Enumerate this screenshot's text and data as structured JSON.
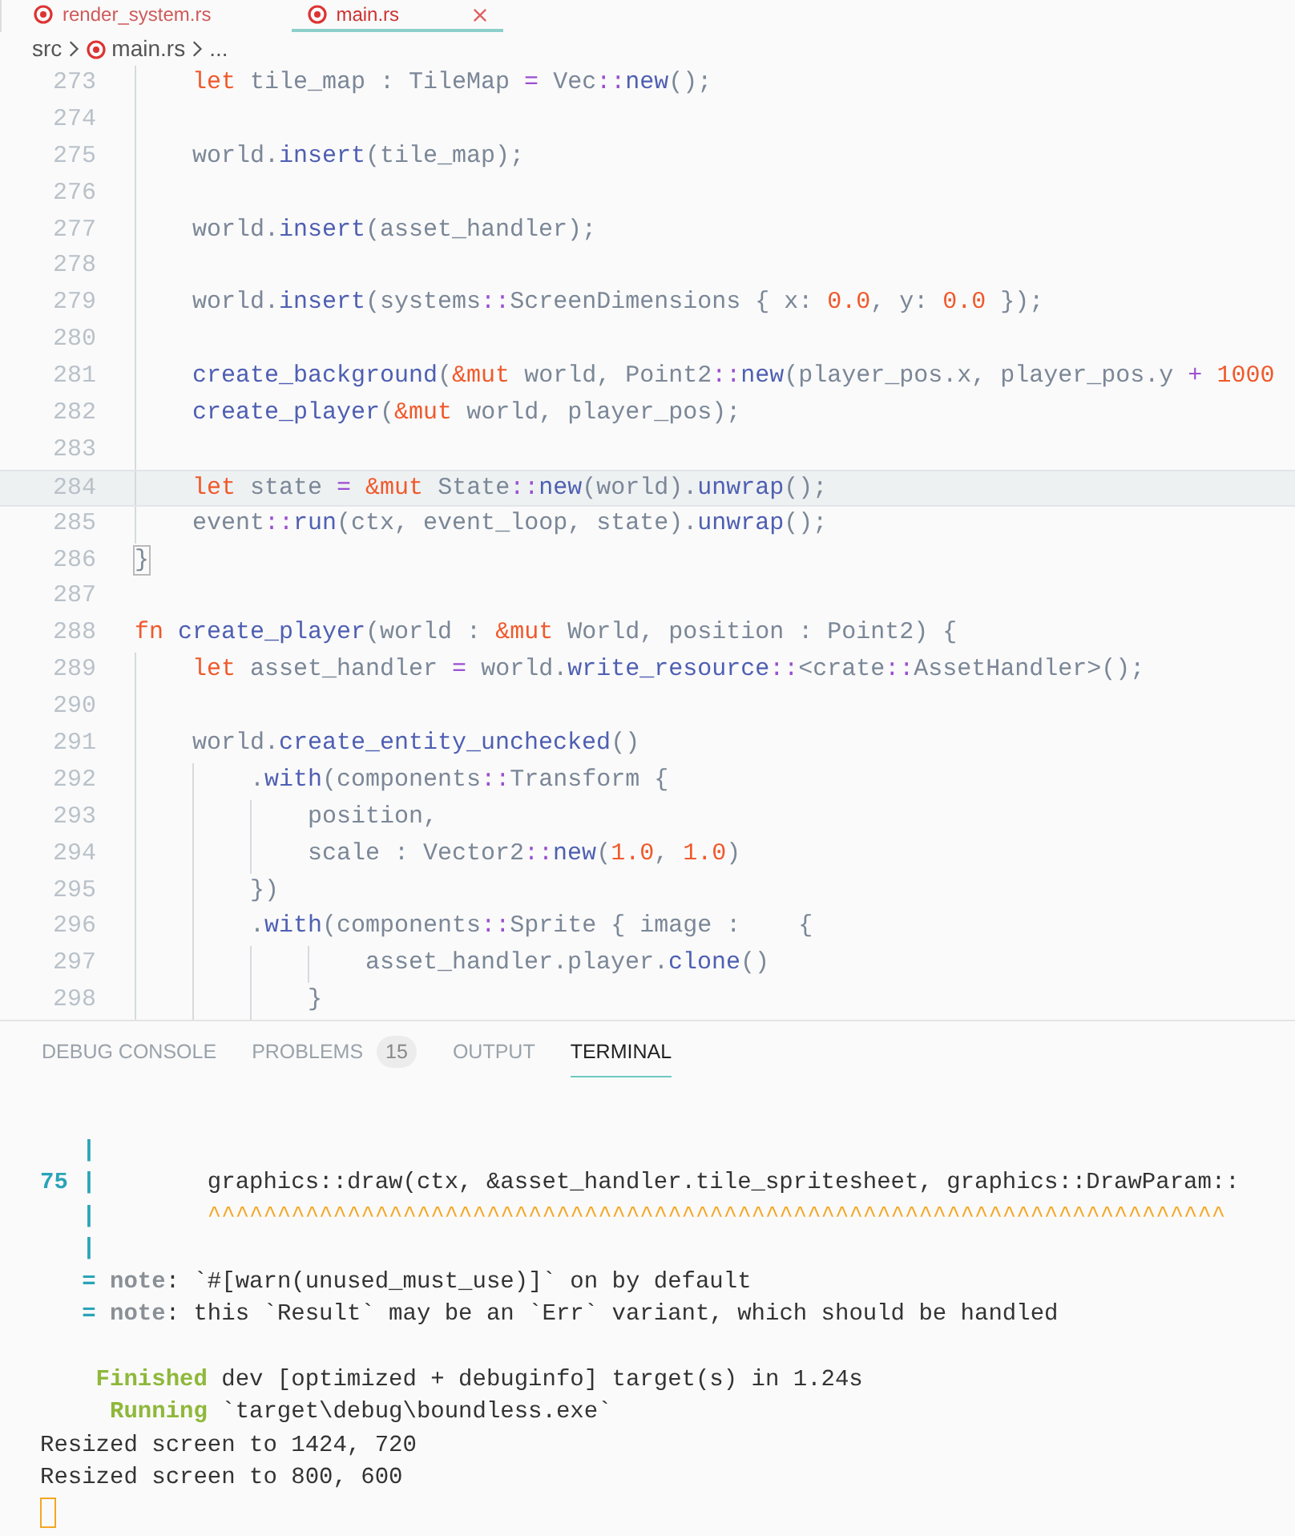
{
  "tabs": [
    {
      "label": "render_system.rs",
      "selected": false
    },
    {
      "label": "main.rs",
      "selected": true
    }
  ],
  "breadcrumb": [
    "src",
    "main.rs",
    "..."
  ],
  "editor": {
    "lines": [
      {
        "number": "273",
        "kind": "indent1",
        "current": false,
        "tokens": [
          {
            "text": "let",
            "kind": "kw"
          },
          {
            "text": " tile_map : TileMap ",
            "kind": "plain"
          },
          {
            "text": "=",
            "kind": "op"
          },
          {
            "text": " Vec",
            "kind": "plain"
          },
          {
            "text": "::",
            "kind": "op"
          },
          {
            "text": "new",
            "kind": "fn"
          },
          {
            "text": "();",
            "kind": "plain"
          }
        ]
      },
      {
        "number": "274",
        "kind": "indent1",
        "current": false
      },
      {
        "number": "275",
        "kind": "indent1",
        "current": false,
        "tokens": [
          {
            "text": "world.",
            "kind": "plain"
          },
          {
            "text": "insert",
            "kind": "fn"
          },
          {
            "text": "(tile_map);",
            "kind": "plain"
          }
        ]
      },
      {
        "number": "276",
        "kind": "indent1",
        "current": false
      },
      {
        "number": "277",
        "kind": "indent1",
        "current": false,
        "tokens": [
          {
            "text": "world.",
            "kind": "plain"
          },
          {
            "text": "insert",
            "kind": "fn"
          },
          {
            "text": "(asset_handler);",
            "kind": "plain"
          }
        ]
      },
      {
        "number": "278",
        "kind": "indent1",
        "current": false
      },
      {
        "number": "279",
        "kind": "indent1",
        "current": false,
        "tokens": [
          {
            "text": "world.",
            "kind": "plain"
          },
          {
            "text": "insert",
            "kind": "fn"
          },
          {
            "text": "(systems",
            "kind": "plain"
          },
          {
            "text": "::",
            "kind": "op"
          },
          {
            "text": "ScreenDimensions { x: ",
            "kind": "plain"
          },
          {
            "text": "0.0",
            "kind": "num"
          },
          {
            "text": ", y: ",
            "kind": "plain"
          },
          {
            "text": "0.0",
            "kind": "num"
          },
          {
            "text": " });",
            "kind": "plain"
          }
        ]
      },
      {
        "number": "280",
        "kind": "indent1",
        "current": false
      },
      {
        "number": "281",
        "kind": "indent1",
        "current": false,
        "tokens": [
          {
            "text": "create_background",
            "kind": "fn"
          },
          {
            "text": "(",
            "kind": "plain"
          },
          {
            "text": "&mut",
            "kind": "kw"
          },
          {
            "text": " world, Point2",
            "kind": "plain"
          },
          {
            "text": "::",
            "kind": "op"
          },
          {
            "text": "new",
            "kind": "fn"
          },
          {
            "text": "(player_pos.x, player_pos.y ",
            "kind": "plain"
          },
          {
            "text": "+ ",
            "kind": "op"
          },
          {
            "text": "1000",
            "kind": "num"
          }
        ]
      },
      {
        "number": "282",
        "kind": "indent1",
        "current": false,
        "tokens": [
          {
            "text": "create_player",
            "kind": "fn"
          },
          {
            "text": "(",
            "kind": "plain"
          },
          {
            "text": "&mut",
            "kind": "kw"
          },
          {
            "text": " world, player_pos);",
            "kind": "plain"
          }
        ]
      },
      {
        "number": "283",
        "kind": "indent1",
        "current": false
      },
      {
        "number": "284",
        "kind": "indent1",
        "current": true,
        "tokens": [
          {
            "text": "let",
            "kind": "kw"
          },
          {
            "text": " state ",
            "kind": "plain"
          },
          {
            "text": "= ",
            "kind": "op"
          },
          {
            "text": "&mut",
            "kind": "kw"
          },
          {
            "text": " State",
            "kind": "plain"
          },
          {
            "text": "::",
            "kind": "op"
          },
          {
            "text": "new",
            "kind": "fn"
          },
          {
            "text": "(world).",
            "kind": "plain"
          },
          {
            "text": "unwrap",
            "kind": "fn"
          },
          {
            "text": "();",
            "kind": "plain"
          }
        ]
      },
      {
        "number": "285",
        "kind": "indent1",
        "current": false,
        "tokens": [
          {
            "text": "event",
            "kind": "plain"
          },
          {
            "text": "::",
            "kind": "op"
          },
          {
            "text": "run",
            "kind": "fn"
          },
          {
            "text": "(ctx, event_loop, state).",
            "kind": "plain"
          },
          {
            "text": "unwrap",
            "kind": "fn"
          },
          {
            "text": "();",
            "kind": "plain"
          }
        ]
      },
      {
        "number": "286",
        "kind": "indent0",
        "current": false,
        "tokens": [
          {
            "text": "}",
            "kind": "match"
          }
        ]
      },
      {
        "number": "287",
        "kind": "indent0",
        "current": false
      },
      {
        "number": "288",
        "kind": "indent0",
        "current": false,
        "tokens": [
          {
            "text": "fn ",
            "kind": "kw"
          },
          {
            "text": "create_player",
            "kind": "fn"
          },
          {
            "text": "(world : ",
            "kind": "plain"
          },
          {
            "text": "&mut",
            "kind": "kw"
          },
          {
            "text": " World, position : Point2) {",
            "kind": "plain"
          }
        ]
      },
      {
        "number": "289",
        "kind": "indent1",
        "current": false,
        "tokens": [
          {
            "text": "let",
            "kind": "kw"
          },
          {
            "text": " asset_handler ",
            "kind": "plain"
          },
          {
            "text": "=",
            "kind": "op"
          },
          {
            "text": " world.",
            "kind": "plain"
          },
          {
            "text": "write_resource",
            "kind": "fn"
          },
          {
            "text": "::",
            "kind": "op"
          },
          {
            "text": "<crate",
            "kind": "plain"
          },
          {
            "text": "::",
            "kind": "op"
          },
          {
            "text": "AssetHandler>();",
            "kind": "plain"
          }
        ]
      },
      {
        "number": "290",
        "kind": "indent1",
        "current": false
      },
      {
        "number": "291",
        "kind": "indent1",
        "current": false,
        "tokens": [
          {
            "text": "world.",
            "kind": "plain"
          },
          {
            "text": "create_entity_unchecked",
            "kind": "fn"
          },
          {
            "text": "()",
            "kind": "plain"
          }
        ]
      },
      {
        "number": "292",
        "kind": "indent2",
        "current": false,
        "tokens": [
          {
            "text": ".",
            "kind": "plain"
          },
          {
            "text": "with",
            "kind": "fn"
          },
          {
            "text": "(components",
            "kind": "plain"
          },
          {
            "text": "::",
            "kind": "op"
          },
          {
            "text": "Transform {",
            "kind": "plain"
          }
        ]
      },
      {
        "number": "293",
        "kind": "indent3",
        "current": false,
        "tokens": [
          {
            "text": "position,",
            "kind": "plain"
          }
        ]
      },
      {
        "number": "294",
        "kind": "indent3",
        "current": false,
        "tokens": [
          {
            "text": "scale : Vector2",
            "kind": "plain"
          },
          {
            "text": "::",
            "kind": "op"
          },
          {
            "text": "new",
            "kind": "fn"
          },
          {
            "text": "(",
            "kind": "plain"
          },
          {
            "text": "1.0",
            "kind": "num"
          },
          {
            "text": ", ",
            "kind": "plain"
          },
          {
            "text": "1.0",
            "kind": "num"
          },
          {
            "text": ")",
            "kind": "plain"
          }
        ]
      },
      {
        "number": "295",
        "kind": "indent2",
        "current": false,
        "tokens": [
          {
            "text": "})",
            "kind": "plain"
          }
        ]
      },
      {
        "number": "296",
        "kind": "indent2",
        "current": false,
        "tokens": [
          {
            "text": ".",
            "kind": "plain"
          },
          {
            "text": "with",
            "kind": "fn"
          },
          {
            "text": "(components",
            "kind": "plain"
          },
          {
            "text": "::",
            "kind": "op"
          },
          {
            "text": "Sprite { image :    {",
            "kind": "plain"
          }
        ]
      },
      {
        "number": "297",
        "kind": "indent4",
        "current": false,
        "tokens": [
          {
            "text": "asset_handler.player.",
            "kind": "plain"
          },
          {
            "text": "clone",
            "kind": "fn"
          },
          {
            "text": "()",
            "kind": "plain"
          }
        ]
      },
      {
        "number": "298",
        "kind": "indent3",
        "current": false,
        "tokens": [
          {
            "text": "}",
            "kind": "plain"
          }
        ]
      }
    ]
  },
  "panel": {
    "tabs": [
      {
        "label": "DEBUG CONSOLE",
        "selected": false
      },
      {
        "label": "PROBLEMS",
        "badge": "15",
        "selected": false
      },
      {
        "label": "OUTPUT",
        "selected": false
      },
      {
        "label": "TERMINAL",
        "selected": true
      }
    ],
    "terminal": [
      {
        "tokens": [
          {
            "text": "   |",
            "kind": "gutter"
          }
        ]
      },
      {
        "tokens": [
          {
            "text": "75 |",
            "kind": "gutter"
          },
          {
            "text": "        graphics::draw(ctx, &asset_handler.tile_spritesheet, graphics::DrawParam::",
            "kind": "plain"
          }
        ]
      },
      {
        "tokens": [
          {
            "text": "   |",
            "kind": "gutter"
          },
          {
            "text": "        ^^^^^^^^^^^^^^^^^^^^^^^^^^^^^^^^^^^^^^^^^^^^^^^^^^^^^^^^^^^^^^^^^^^^^^^^^",
            "kind": "warn"
          }
        ]
      },
      {
        "tokens": [
          {
            "text": "   |",
            "kind": "gutter"
          }
        ]
      },
      {
        "tokens": [
          {
            "text": "   =",
            "kind": "gutter"
          },
          {
            "text": " note",
            "kind": "note"
          },
          {
            "text": ": `#[warn(unused_must_use)]` on by default",
            "kind": "plain"
          }
        ]
      },
      {
        "tokens": [
          {
            "text": "   =",
            "kind": "gutter"
          },
          {
            "text": " note",
            "kind": "note"
          },
          {
            "text": ": this `Result` may be an `Err` variant, which should be handled",
            "kind": "plain"
          }
        ]
      },
      {
        "gap_before": true,
        "tokens": [
          {
            "text": "    Finished",
            "kind": "ok"
          },
          {
            "text": " dev [optimized + debuginfo] target(s) in 1.24s",
            "kind": "plain"
          }
        ]
      },
      {
        "tokens": [
          {
            "text": "     Running",
            "kind": "ok"
          },
          {
            "text": " `target\\debug\\boundless.exe`",
            "kind": "plain"
          }
        ]
      },
      {
        "tokens": [
          {
            "text": "Resized screen to 1424, 720",
            "kind": "plain"
          }
        ]
      },
      {
        "tokens": [
          {
            "text": "Resized screen to 800, 600",
            "kind": "plain"
          }
        ]
      }
    ]
  }
}
